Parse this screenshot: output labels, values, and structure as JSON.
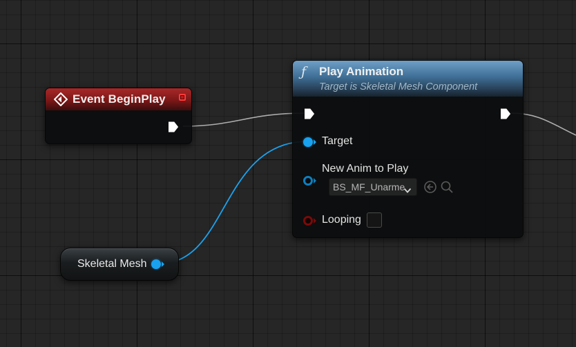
{
  "graph": {
    "event_node": {
      "title": "Event BeginPlay",
      "header_color": "#8b1c1c"
    },
    "function_node": {
      "title": "Play Animation",
      "subtitle": "Target is Skeletal Mesh Component",
      "icon": "function-icon",
      "header_color": "#4c7ba2",
      "pins": {
        "target_label": "Target",
        "anim_label": "New Anim to Play",
        "anim_value": "BS_MF_Unarme",
        "looping_label": "Looping",
        "looping_checked": false
      }
    },
    "variable_node": {
      "title": "Skeletal Mesh"
    },
    "colors": {
      "exec_wire": "#c8c8c8",
      "object_wire": "#1aa3f0",
      "bool_pin": "#7a0a0a"
    }
  }
}
